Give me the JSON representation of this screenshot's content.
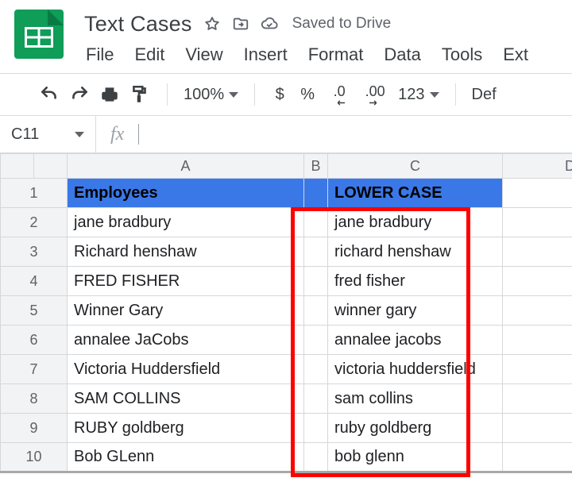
{
  "doc": {
    "title": "Text Cases",
    "saved_label": "Saved to Drive"
  },
  "menus": {
    "file": "File",
    "edit": "Edit",
    "view": "View",
    "insert": "Insert",
    "format": "Format",
    "data": "Data",
    "tools": "Tools",
    "ext": "Ext"
  },
  "toolbar": {
    "zoom": "100%",
    "currency": "$",
    "percent": "%",
    "dec_dec": ".0",
    "inc_dec": ".00",
    "numfmt": "123",
    "font": "Def"
  },
  "namebox": {
    "value": "C11"
  },
  "columns": {
    "a": "A",
    "b": "B",
    "c": "C",
    "d": "D"
  },
  "rows": {
    "header": {
      "a": "Employees",
      "c": "LOWER CASE"
    },
    "r": [
      {
        "n": "1"
      },
      {
        "n": "2",
        "a": "jane bradbury",
        "c": "jane bradbury"
      },
      {
        "n": "3",
        "a": "Richard henshaw",
        "c": "richard henshaw"
      },
      {
        "n": "4",
        "a": "FRED FISHER",
        "c": "fred fisher"
      },
      {
        "n": "5",
        "a": "Winner Gary",
        "c": "winner gary"
      },
      {
        "n": "6",
        "a": "annalee JaCobs",
        "c": "annalee jacobs"
      },
      {
        "n": "7",
        "a": "Victoria Huddersfield",
        "c": "victoria huddersfield"
      },
      {
        "n": "8",
        "a": "SAM COLLINS",
        "c": "sam collins"
      },
      {
        "n": "9",
        "a": "RUBY goldberg",
        "c": "ruby goldberg"
      },
      {
        "n": "10",
        "a": "Bob GLenn",
        "c": "bob glenn"
      }
    ]
  }
}
